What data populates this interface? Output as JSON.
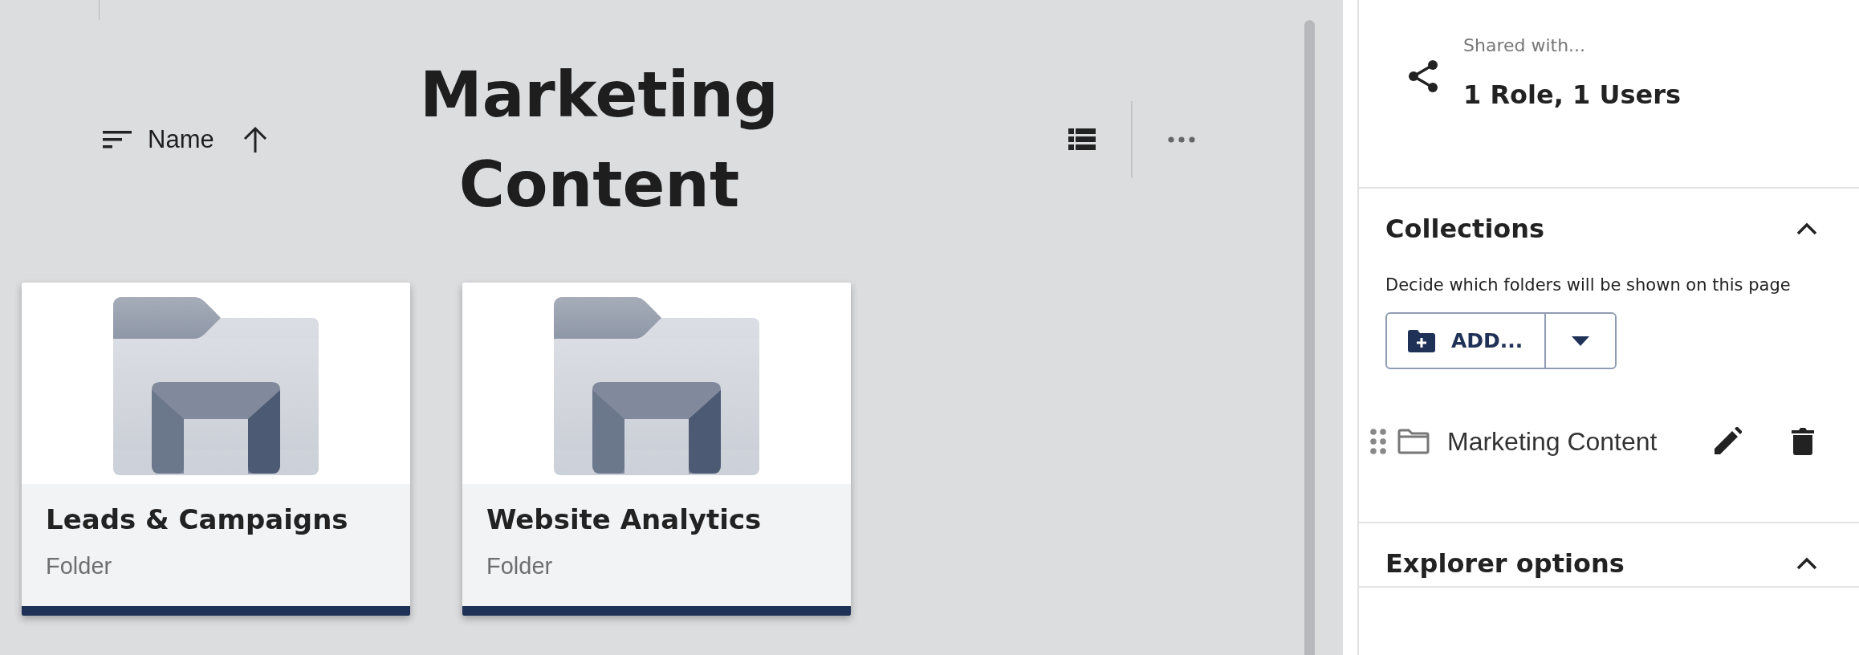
{
  "toolbar": {
    "sort": {
      "label": "Name",
      "ascending": true
    },
    "title": "Marketing Content"
  },
  "cards": [
    {
      "title": "Leads & Campaigns",
      "subtitle": "Folder"
    },
    {
      "title": "Website Analytics",
      "subtitle": "Folder"
    }
  ],
  "panel": {
    "shared": {
      "label": "Shared with...",
      "value": "1 Role, 1 Users"
    },
    "sections": [
      {
        "title": "Collections",
        "expanded": true,
        "description": "Decide which folders will be shown on this page",
        "add_button": {
          "label": "ADD..."
        },
        "items": [
          {
            "label": "Marketing Content"
          }
        ]
      },
      {
        "title": "Explorer options",
        "expanded": true
      }
    ]
  }
}
